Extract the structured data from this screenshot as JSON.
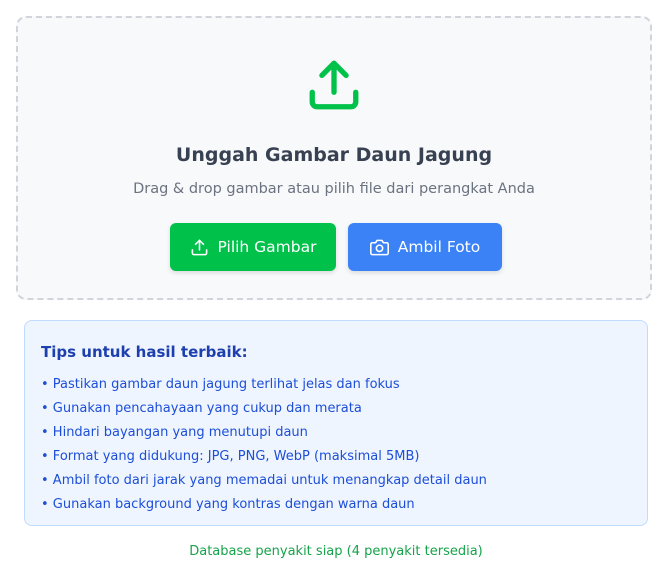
{
  "upload": {
    "title": "Unggah Gambar Daun Jagung",
    "subtitle": "Drag & drop gambar atau pilih file dari perangkat Anda",
    "choose_label": "Pilih Gambar",
    "camera_label": "Ambil Foto"
  },
  "tips": {
    "title": "Tips untuk hasil terbaik:",
    "items": [
      "• Pastikan gambar daun jagung terlihat jelas dan fokus",
      "• Gunakan pencahayaan yang cukup dan merata",
      "• Hindari bayangan yang menutupi daun",
      "• Format yang didukung: JPG, PNG, WebP (maksimal 5MB)",
      "• Ambil foto dari jarak yang memadai untuk menangkap detail daun",
      "• Gunakan background yang kontras dengan warna daun"
    ]
  },
  "status": "Database penyakit siap (4 penyakit tersedia)",
  "icons": {
    "upload_large": "upload-icon",
    "choose_button": "upload-icon",
    "camera_button": "camera-icon"
  },
  "colors": {
    "green": "#00c24a",
    "blue": "#3b82f6",
    "tips_text": "#1d4ed8",
    "status_text": "#16a34a"
  }
}
